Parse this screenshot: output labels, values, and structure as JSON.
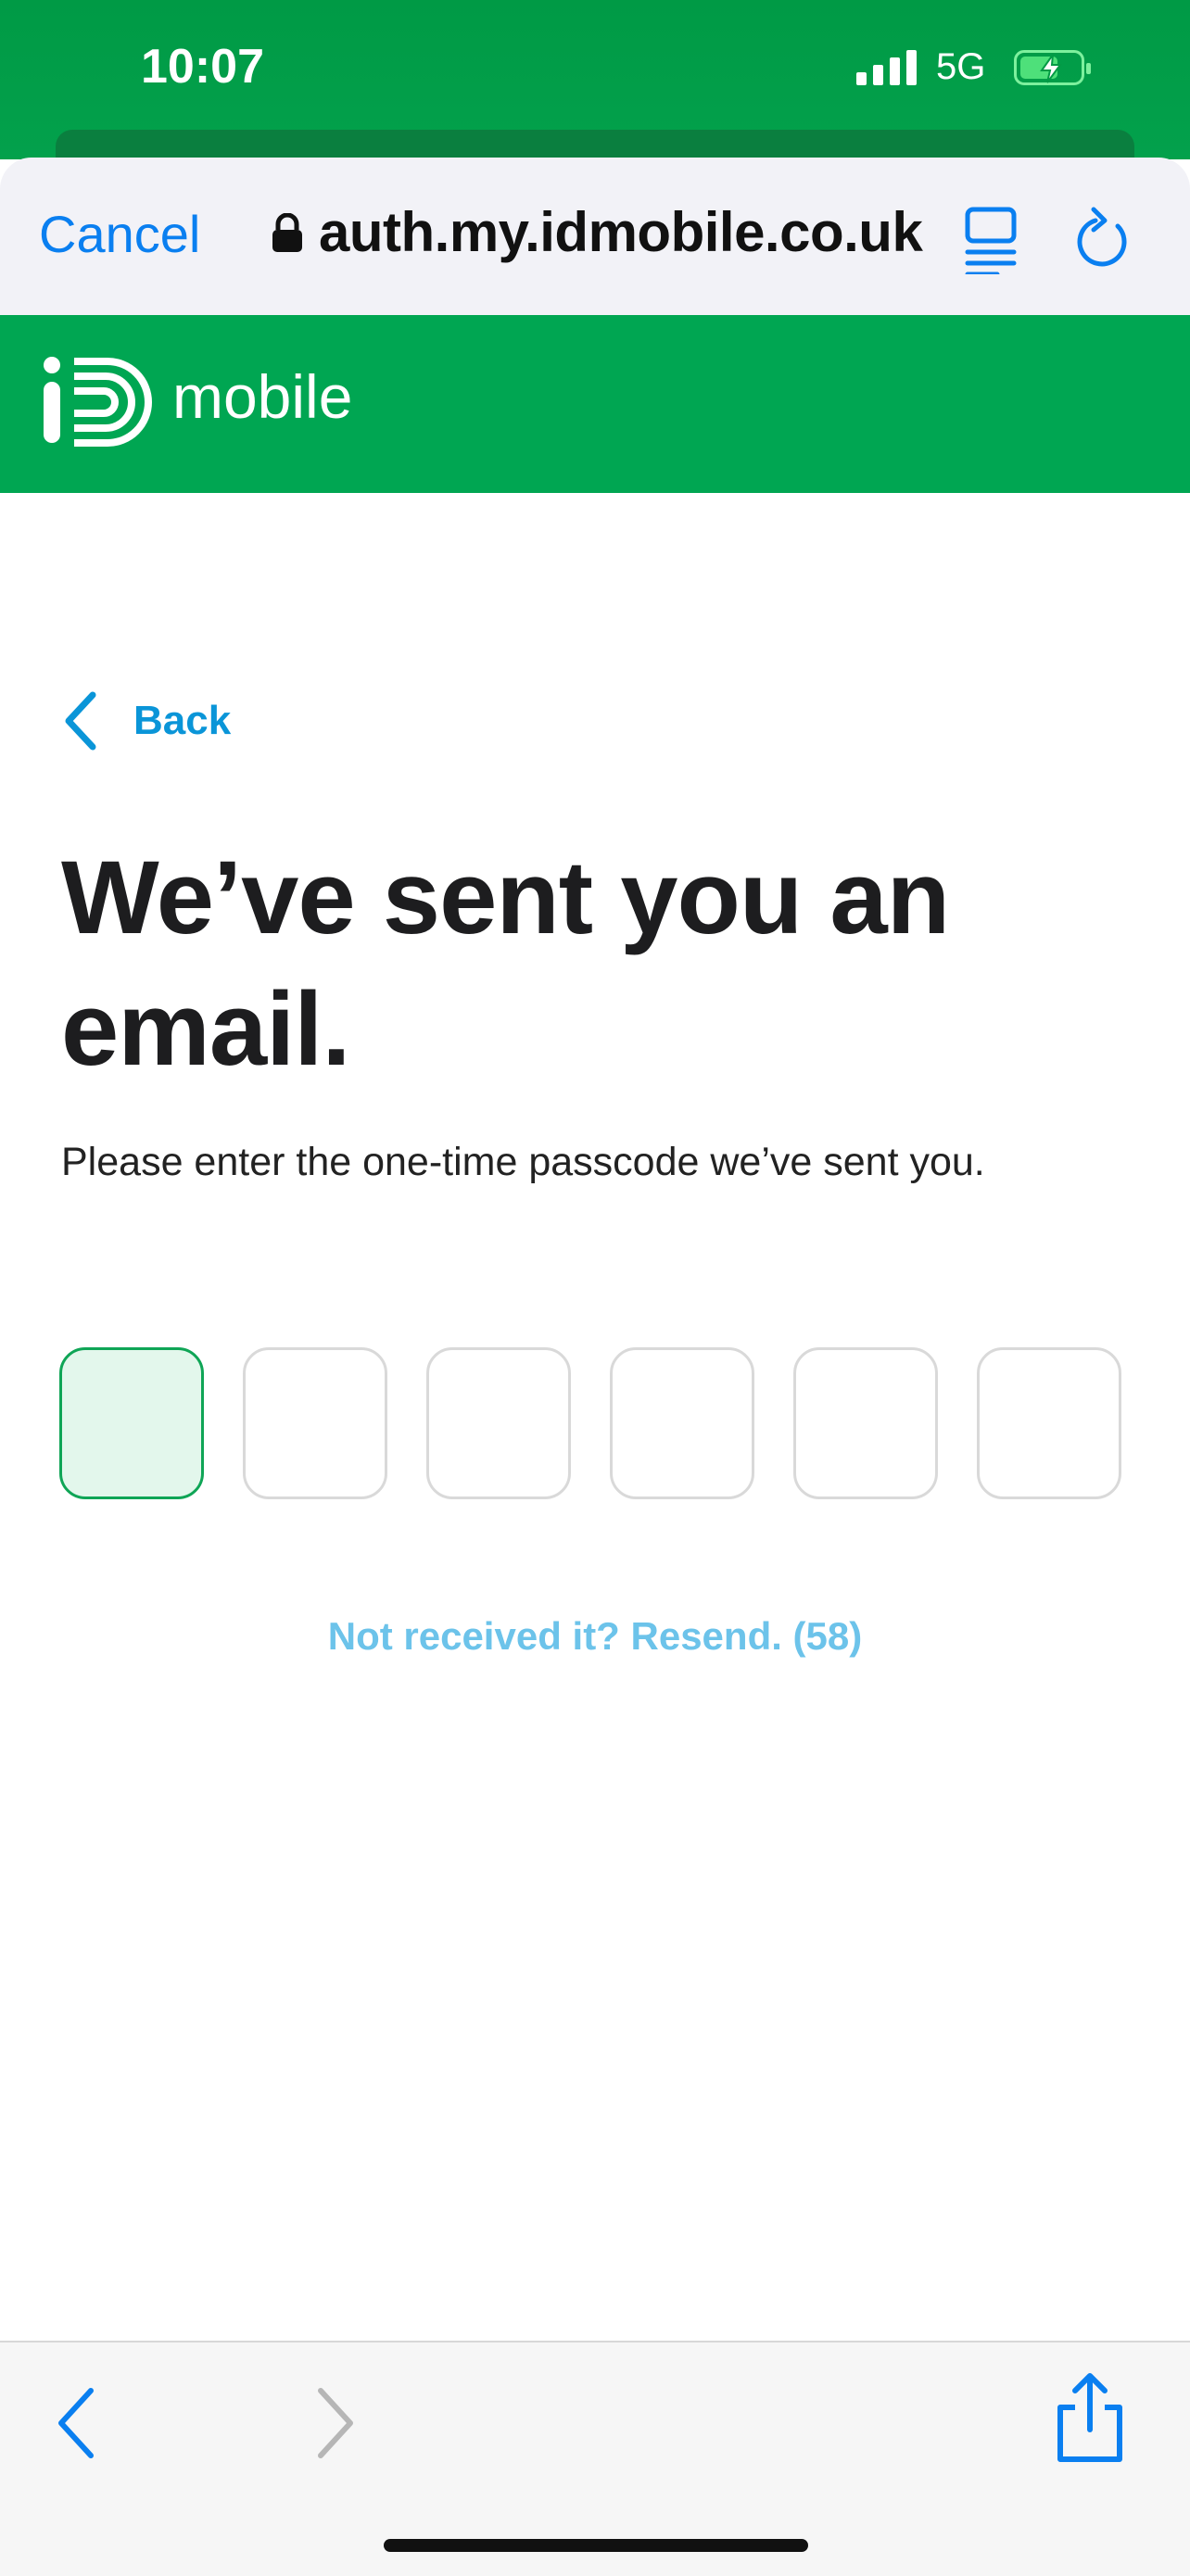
{
  "status_bar": {
    "time": "10:07",
    "network": "5G",
    "icons": [
      "signal-icon",
      "battery-charging-icon"
    ]
  },
  "browser": {
    "cancel_label": "Cancel",
    "url": "auth.my.idmobile.co.uk",
    "icons": [
      "lock-icon",
      "reader-icon",
      "reload-icon"
    ],
    "accent_color": "#0a7ff0"
  },
  "brand": {
    "name": "mobile",
    "color": "#00a652"
  },
  "page": {
    "back_label": "Back",
    "title": "We’ve sent you an email.",
    "subtitle": "Please enter the one-time passcode we’ve sent you.",
    "otp_digits": [
      "",
      "",
      "",
      "",
      "",
      ""
    ],
    "resend_label": "Not received it? Resend. (58)"
  },
  "toolbar": {
    "icons": [
      "back-arrow-icon",
      "forward-arrow-icon",
      "share-icon"
    ]
  }
}
